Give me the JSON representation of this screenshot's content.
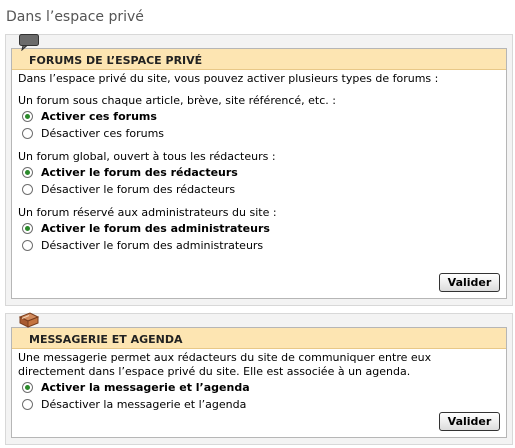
{
  "page_title": "Dans l’espace privé",
  "forums": {
    "title": "FORUMS DE L’ESPACE PRIVÉ",
    "intro": "Dans l’espace privé du site, vous pouvez activer plusieurs types de forums :",
    "groups": [
      {
        "question": "Un forum sous chaque article, brève, site référencé, etc. :",
        "options": [
          {
            "label": "Activer ces forums",
            "selected": true
          },
          {
            "label": "Désactiver ces forums",
            "selected": false
          }
        ]
      },
      {
        "question": "Un forum global, ouvert à tous les rédacteurs :",
        "options": [
          {
            "label": "Activer le forum des rédacteurs",
            "selected": true
          },
          {
            "label": "Désactiver le forum des rédacteurs",
            "selected": false
          }
        ]
      },
      {
        "question": "Un forum réservé aux administrateurs du site :",
        "options": [
          {
            "label": "Activer le forum des administrateurs",
            "selected": true
          },
          {
            "label": "Désactiver le forum des administrateurs",
            "selected": false
          }
        ]
      }
    ],
    "submit_label": "Valider",
    "icon": "speech-bubble-icon"
  },
  "messagerie": {
    "title": "MESSAGERIE ET AGENDA",
    "intro_line1": "Une messagerie permet aux rédacteurs du site de communiquer entre eux",
    "intro_line2": "directement dans l’espace privé du site. Elle est associée à un agenda.",
    "options": [
      {
        "label": "Activer la messagerie et l’agenda",
        "selected": true
      },
      {
        "label": "Désactiver la messagerie et l’agenda",
        "selected": false
      }
    ],
    "submit_label": "Valider",
    "icon": "book-icon"
  }
}
